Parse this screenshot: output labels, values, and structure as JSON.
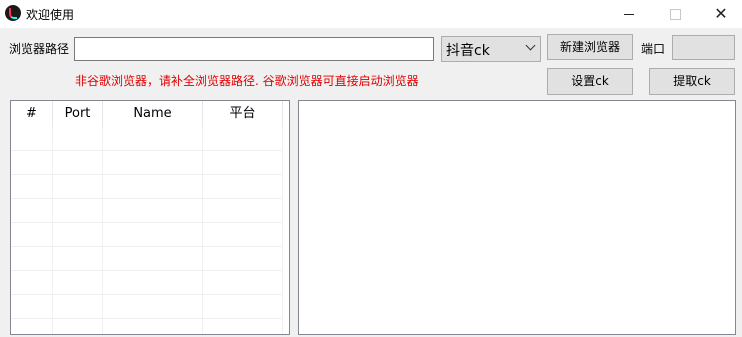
{
  "window": {
    "title": "欢迎使用",
    "controls": {
      "minimize": "",
      "maximize": "",
      "close": "✕"
    }
  },
  "form": {
    "browser_path_label": "浏览器路径",
    "browser_path_value": "",
    "platform_select_value": "抖音ck",
    "new_browser_button": "新建浏览器",
    "port_label": "端口",
    "port_value": "",
    "set_ck_button": "设置ck",
    "get_ck_button": "提取ck",
    "warning_text": "非谷歌浏览器，请补全浏览器路径. 谷歌浏览器可直接启动浏览器"
  },
  "listview": {
    "columns": [
      "#",
      "Port",
      "Name",
      "平台"
    ],
    "rows": []
  },
  "log": {
    "content": ""
  },
  "colors": {
    "warning": "#e00000",
    "title_bg": "#ffffff",
    "body_bg": "#f0f0f0"
  },
  "icons": {
    "app": "douyin-logo-icon"
  }
}
